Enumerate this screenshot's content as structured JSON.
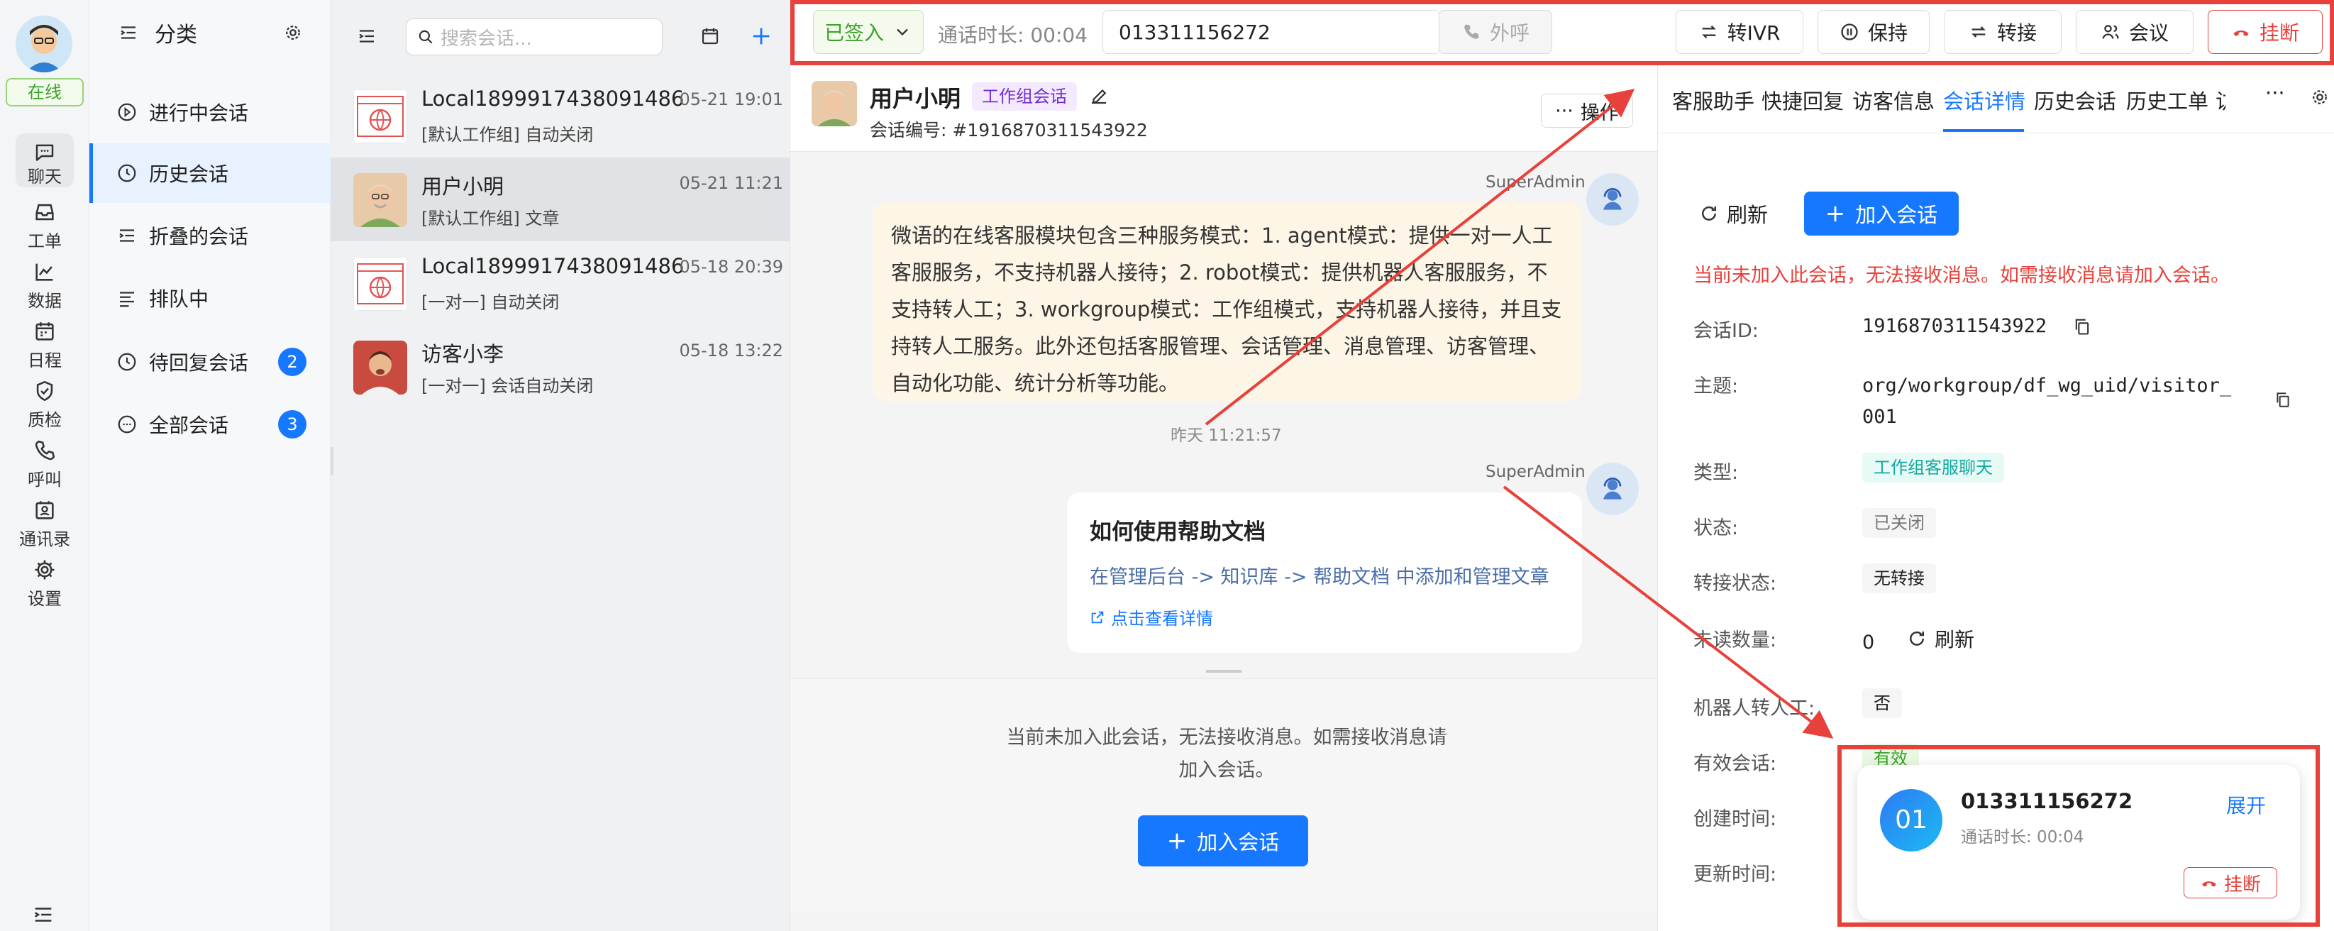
{
  "rail": {
    "status": "在线",
    "items": [
      "聊天",
      "工单",
      "数据",
      "日程",
      "质检",
      "呼叫",
      "通讯录",
      "设置"
    ]
  },
  "category": {
    "title": "分类",
    "items": [
      {
        "label": "进行中会话"
      },
      {
        "label": "历史会话"
      },
      {
        "label": "折叠的会话"
      },
      {
        "label": "排队中"
      },
      {
        "label": "待回复会话",
        "badge": "2"
      },
      {
        "label": "全部会话",
        "badge": "3"
      }
    ]
  },
  "list": {
    "search_placeholder": "搜索会话...",
    "conversations": [
      {
        "name": "Local1899917438091486",
        "time": "05-21 19:01",
        "sub": "[默认工作组] 自动关闭"
      },
      {
        "name": "用户小明",
        "time": "05-21 11:21",
        "sub": "[默认工作组] 文章"
      },
      {
        "name": "Local1899917438091486",
        "time": "05-18 20:39",
        "sub": "[一对一] 自动关闭"
      },
      {
        "name": "访客小李",
        "time": "05-18 13:22",
        "sub": "[一对一] 会话自动关闭"
      }
    ]
  },
  "callbar": {
    "status": "已签入",
    "duration": "通话时长: 00:04",
    "number": "013311156272",
    "dial": "外呼",
    "ivr": "转IVR",
    "hold": "保持",
    "transfer": "转接",
    "meeting": "会议",
    "hangup": "挂断"
  },
  "chat": {
    "user": "用户小明",
    "tag": "工作组会话",
    "conv_no": "会话编号: #1916870311543922",
    "ops": "操作",
    "sender1": "SuperAdmin",
    "message1": "微语的在线客服模块包含三种服务模式：1. agent模式：提供一对一人工客服服务，不支持机器人接待；2. robot模式：提供机器人客服服务，不支持转人工；3. workgroup模式：工作组模式，支持机器人接待，并且支持转人工服务。此外还包括客服管理、会话管理、消息管理、访客管理、自动化功能、统计分析等功能。",
    "time1": "昨天 11:21:57",
    "sender2": "SuperAdmin",
    "card_title": "如何使用帮助文档",
    "card_desc": "在管理后台 -> 知识库 -> 帮助文档 中添加和管理文章",
    "card_link": "点击查看详情",
    "notice": "当前未加入此会话，无法接收消息。如需接收消息请加入会话。",
    "join": "加入会话"
  },
  "right": {
    "tabs": [
      "客服助手",
      "快捷回复",
      "访客信息",
      "会话详情",
      "历史会话",
      "历史工单",
      "访"
    ],
    "more": "···",
    "refresh": "刷新",
    "join": "加入会话",
    "warning": "当前未加入此会话，无法接收消息。如需接收消息请加入会话。",
    "fields": {
      "id_label": "会话ID:",
      "id_value": "1916870311543922",
      "topic_label": "主题:",
      "topic_value1": "org/workgroup/df_wg_uid/visitor_",
      "topic_value2": "001",
      "type_label": "类型:",
      "type_value": "工作组客服聊天",
      "state_label": "状态:",
      "state_value": "已关闭",
      "transfer_label": "转接状态:",
      "transfer_value": "无转接",
      "unread_label": "未读数量:",
      "unread_value": "0",
      "unread_refresh": "刷新",
      "robot_label": "机器人转人工:",
      "robot_value": "否",
      "valid_label": "有效会话:",
      "valid_value": "有效",
      "created_label": "创建时间:",
      "updated_label": "更新时间:"
    }
  },
  "popup": {
    "avatar": "01",
    "number": "013311156272",
    "duration": "通话时长: 00:04",
    "expand": "展开",
    "hangup": "挂断"
  },
  "colors": {
    "accent": "#1677ff",
    "danger": "#e8403a",
    "success": "#3aa428"
  }
}
